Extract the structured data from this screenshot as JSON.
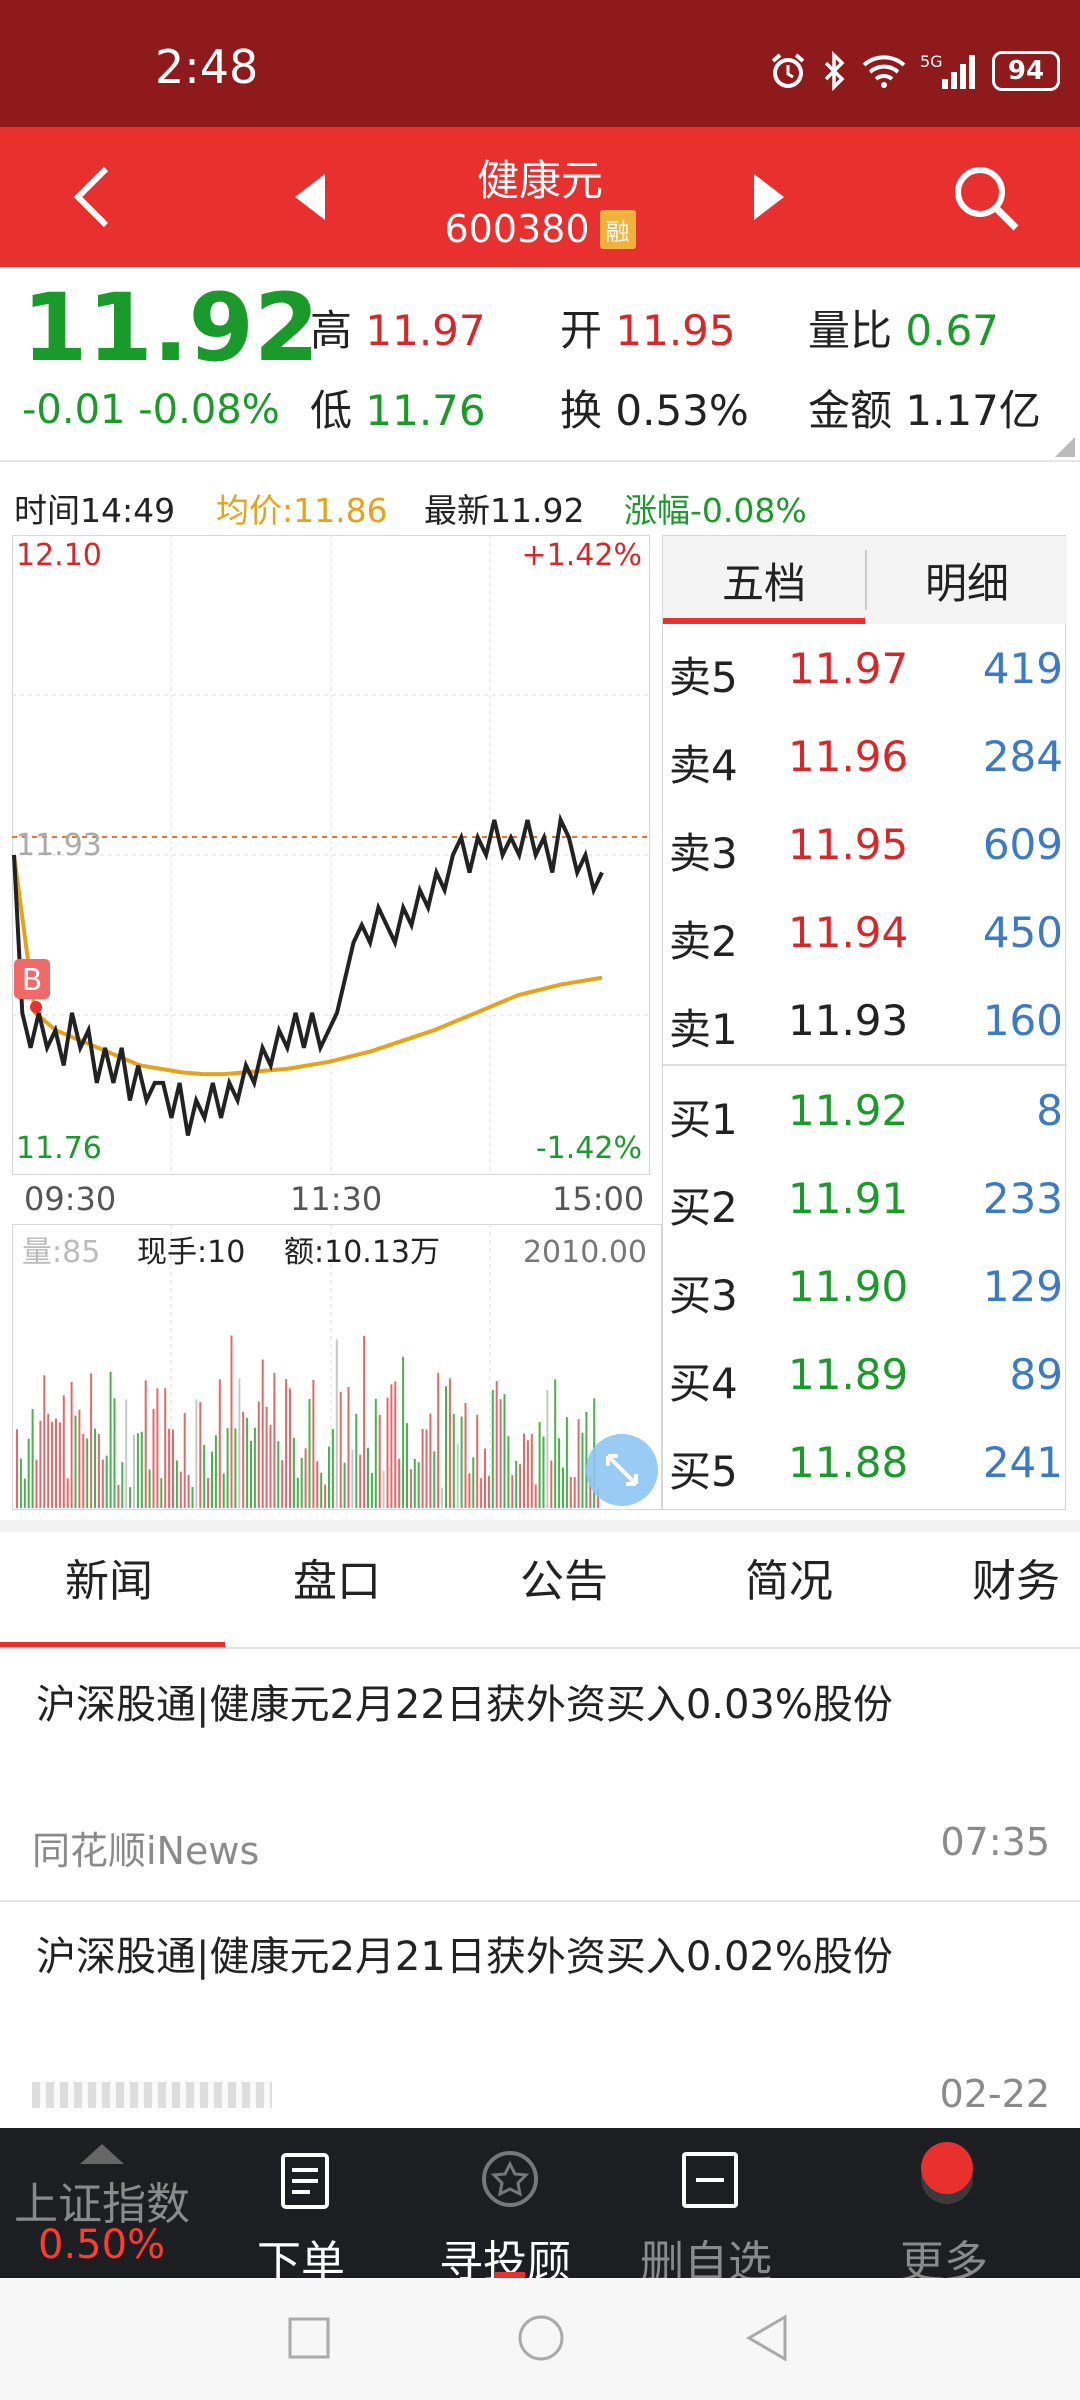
{
  "status": {
    "time": "2:48",
    "battery": "94",
    "signal": "5G"
  },
  "header": {
    "name": "健康元",
    "code": "600380",
    "badge": "融"
  },
  "quote": {
    "price": "11.92",
    "change": "-0.01",
    "change_pct": "-0.08%",
    "high_label": "高",
    "high": "11.97",
    "open_label": "开",
    "open": "11.95",
    "vr_label": "量比",
    "vr": "0.67",
    "low_label": "低",
    "low": "11.76",
    "turnover_label": "换",
    "turnover": "0.53%",
    "amount_label": "金额",
    "amount": "1.17亿"
  },
  "infobar": {
    "time": "时间14:49",
    "avg": "均价:11.86",
    "latest": "最新11.92",
    "pct": "涨幅-0.08%"
  },
  "chart_data": {
    "type": "line",
    "title": "",
    "x_ticks": [
      "09:30",
      "11:30",
      "15:00"
    ],
    "y_top": "12.10",
    "y_bottom": "11.76",
    "y_ref": "11.93",
    "pct_top": "+1.42%",
    "pct_bottom": "-1.42%",
    "marker": "B",
    "ylim": [
      11.76,
      12.1
    ],
    "price_y": [
      11.93,
      11.84,
      11.82,
      11.84,
      11.82,
      11.83,
      11.81,
      11.84,
      11.82,
      11.83,
      11.8,
      11.82,
      11.8,
      11.82,
      11.79,
      11.81,
      11.79,
      11.8,
      11.8,
      11.78,
      11.8,
      11.77,
      11.79,
      11.78,
      11.8,
      11.78,
      11.8,
      11.79,
      11.81,
      11.8,
      11.82,
      11.81,
      11.83,
      11.82,
      11.84,
      11.82,
      11.84,
      11.82,
      11.83,
      11.84,
      11.86,
      11.88,
      11.89,
      11.88,
      11.9,
      11.89,
      11.88,
      11.9,
      11.89,
      11.91,
      11.9,
      11.92,
      11.91,
      11.93,
      11.94,
      11.92,
      11.94,
      11.93,
      11.95,
      11.93,
      11.94,
      11.93,
      11.95,
      11.93,
      11.94,
      11.92,
      11.95,
      11.94,
      11.92,
      11.93,
      11.91,
      11.92
    ],
    "avg_y": [
      11.93,
      11.84,
      11.83,
      11.825,
      11.82,
      11.815,
      11.81,
      11.808,
      11.806,
      11.805,
      11.805,
      11.806,
      11.807,
      11.808,
      11.81,
      11.812,
      11.815,
      11.818,
      11.822,
      11.826,
      11.83,
      11.835,
      11.84,
      11.845,
      11.85,
      11.853,
      11.856,
      11.858,
      11.86
    ],
    "volume_label": "量:85",
    "vol_now": "现手:10",
    "vol_amt": "额:10.13万",
    "vol_max": "2010.00"
  },
  "orderbook": {
    "tab_five": "五档",
    "tab_detail": "明细",
    "sells": [
      {
        "label": "卖5",
        "price": "11.97",
        "vol": "419"
      },
      {
        "label": "卖4",
        "price": "11.96",
        "vol": "284"
      },
      {
        "label": "卖3",
        "price": "11.95",
        "vol": "609"
      },
      {
        "label": "卖2",
        "price": "11.94",
        "vol": "450"
      },
      {
        "label": "卖1",
        "price": "11.93",
        "vol": "160"
      }
    ],
    "buys": [
      {
        "label": "买1",
        "price": "11.92",
        "vol": "8"
      },
      {
        "label": "买2",
        "price": "11.91",
        "vol": "233"
      },
      {
        "label": "买3",
        "price": "11.90",
        "vol": "129"
      },
      {
        "label": "买4",
        "price": "11.89",
        "vol": "89"
      },
      {
        "label": "买5",
        "price": "11.88",
        "vol": "241"
      }
    ]
  },
  "tabs": [
    "新闻",
    "盘口",
    "公告",
    "简况",
    "财务"
  ],
  "news": [
    {
      "title": "沪深股通|健康元2月22日获外资买入0.03%股份",
      "source": "同花顺iNews",
      "time": "07:35"
    },
    {
      "title": "沪深股通|健康元2月21日获外资买入0.02%股份",
      "source": "",
      "time": "02-22"
    }
  ],
  "bottomnav": {
    "index_name": "上证指数",
    "index_pct": "0.50%",
    "order": "下单",
    "advisor": "寻投顾",
    "delete": "删自选",
    "more": "更多"
  },
  "colors": {
    "up": "#d8272a",
    "down": "#1a9a2a",
    "avg": "#e5a21c",
    "header": "#e8302f",
    "statusbar": "#8f1a1c"
  }
}
